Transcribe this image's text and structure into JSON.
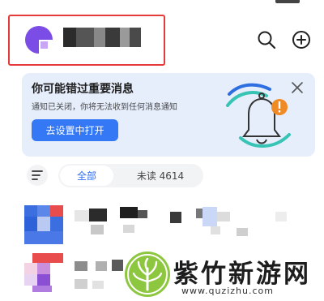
{
  "banner": {
    "title": "你可能错过重要消息",
    "subtitle": "通知已关闭，你将无法收到任何消息通知",
    "cta_label": "去设置中打开"
  },
  "tabs": [
    {
      "label": "全部",
      "selected": true
    },
    {
      "label": "未读 4614",
      "selected": false
    }
  ],
  "watermark": {
    "title": "紫竹新游网",
    "url": "www.quzizhu.com"
  },
  "icons": {
    "search": "search-icon",
    "add": "add-circle-icon",
    "close": "close-icon",
    "filter": "filter-icon",
    "bell": "bell-illustration-icon"
  },
  "colors": {
    "accent": "#3478f6",
    "banner_bg": "#e6eefc",
    "highlight_border": "#e53a3a",
    "badge": "#f08a24"
  }
}
